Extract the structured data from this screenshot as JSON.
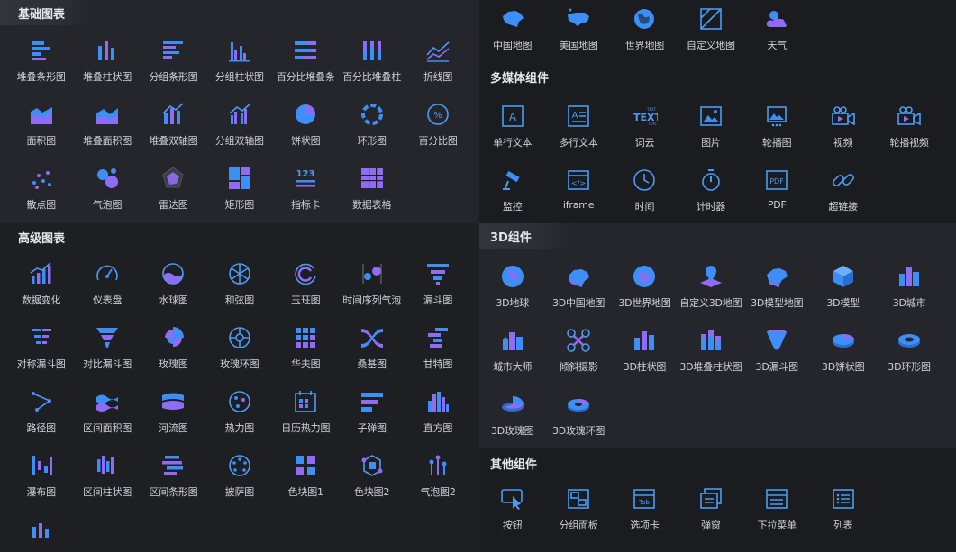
{
  "sections": {
    "basic": {
      "title": "基础图表",
      "items": [
        {
          "label": "堆叠条形图",
          "icon": "stacked-bar-icon"
        },
        {
          "label": "堆叠柱状图",
          "icon": "stacked-column-icon"
        },
        {
          "label": "分组条形图",
          "icon": "grouped-bar-icon"
        },
        {
          "label": "分组柱状图",
          "icon": "grouped-column-icon"
        },
        {
          "label": "百分比堆叠条",
          "icon": "percent-stacked-bar-icon"
        },
        {
          "label": "百分比堆叠柱",
          "icon": "percent-stacked-column-icon"
        },
        {
          "label": "折线图",
          "icon": "line-chart-icon"
        },
        {
          "label": "面积图",
          "icon": "area-chart-icon"
        },
        {
          "label": "堆叠面积图",
          "icon": "stacked-area-icon"
        },
        {
          "label": "堆叠双轴图",
          "icon": "stacked-dual-axis-icon"
        },
        {
          "label": "分组双轴图",
          "icon": "grouped-dual-axis-icon"
        },
        {
          "label": "饼状图",
          "icon": "pie-chart-icon"
        },
        {
          "label": "环形图",
          "icon": "ring-chart-icon"
        },
        {
          "label": "百分比图",
          "icon": "percent-chart-icon"
        },
        {
          "label": "散点图",
          "icon": "scatter-icon"
        },
        {
          "label": "气泡图",
          "icon": "bubble-icon"
        },
        {
          "label": "雷达图",
          "icon": "radar-icon"
        },
        {
          "label": "矩形图",
          "icon": "treemap-icon"
        },
        {
          "label": "指标卡",
          "icon": "kpi-card-icon"
        },
        {
          "label": "数据表格",
          "icon": "data-table-icon"
        }
      ]
    },
    "advanced": {
      "title": "高级图表",
      "items": [
        {
          "label": "数据变化",
          "icon": "data-change-icon"
        },
        {
          "label": "仪表盘",
          "icon": "gauge-icon"
        },
        {
          "label": "水球图",
          "icon": "liquid-fill-icon"
        },
        {
          "label": "和弦图",
          "icon": "chord-icon"
        },
        {
          "label": "玉玨图",
          "icon": "radial-bar-icon"
        },
        {
          "label": "时间序列气泡",
          "icon": "timeline-bubble-icon"
        },
        {
          "label": "漏斗图",
          "icon": "funnel-icon"
        },
        {
          "label": "对称漏斗图",
          "icon": "symmetric-funnel-icon"
        },
        {
          "label": "对比漏斗图",
          "icon": "compare-funnel-icon"
        },
        {
          "label": "玫瑰图",
          "icon": "rose-icon"
        },
        {
          "label": "玫瑰环图",
          "icon": "rose-ring-icon"
        },
        {
          "label": "华夫图",
          "icon": "waffle-icon"
        },
        {
          "label": "桑基图",
          "icon": "sankey-icon"
        },
        {
          "label": "甘特图",
          "icon": "gantt-icon"
        },
        {
          "label": "路径图",
          "icon": "path-icon"
        },
        {
          "label": "区间面积图",
          "icon": "range-area-icon"
        },
        {
          "label": "河流图",
          "icon": "streamgraph-icon"
        },
        {
          "label": "热力图",
          "icon": "heatmap-icon"
        },
        {
          "label": "日历热力图",
          "icon": "calendar-heatmap-icon"
        },
        {
          "label": "子弹图",
          "icon": "bullet-icon"
        },
        {
          "label": "直方图",
          "icon": "histogram-icon"
        },
        {
          "label": "瀑布图",
          "icon": "waterfall-icon"
        },
        {
          "label": "区间柱状图",
          "icon": "range-column-icon"
        },
        {
          "label": "区间条形图",
          "icon": "range-bar-icon"
        },
        {
          "label": "披萨图",
          "icon": "pizza-icon"
        },
        {
          "label": "色块图1",
          "icon": "color-block-icon"
        },
        {
          "label": "色块图2",
          "icon": "color-block-2-icon"
        },
        {
          "label": "气泡图2",
          "icon": "bubble-2-icon"
        },
        {
          "label": "",
          "icon": "column-small-icon"
        }
      ]
    },
    "maps": {
      "items": [
        {
          "label": "中国地图",
          "icon": "china-map-icon"
        },
        {
          "label": "美国地图",
          "icon": "usa-map-icon"
        },
        {
          "label": "世界地图",
          "icon": "world-map-icon"
        },
        {
          "label": "自定义地图",
          "icon": "custom-map-icon"
        },
        {
          "label": "天气",
          "icon": "weather-icon"
        }
      ]
    },
    "media": {
      "title": "多媒体组件",
      "items": [
        {
          "label": "单行文本",
          "icon": "single-line-text-icon"
        },
        {
          "label": "多行文本",
          "icon": "multi-line-text-icon"
        },
        {
          "label": "词云",
          "icon": "word-cloud-icon"
        },
        {
          "label": "图片",
          "icon": "image-icon"
        },
        {
          "label": "轮播图",
          "icon": "carousel-icon"
        },
        {
          "label": "视频",
          "icon": "video-icon"
        },
        {
          "label": "轮播视频",
          "icon": "carousel-video-icon"
        },
        {
          "label": "监控",
          "icon": "camera-monitor-icon"
        },
        {
          "label": "iframe",
          "icon": "iframe-icon"
        },
        {
          "label": "时间",
          "icon": "clock-icon"
        },
        {
          "label": "计时器",
          "icon": "stopwatch-icon"
        },
        {
          "label": "PDF",
          "icon": "pdf-icon"
        },
        {
          "label": "超链接",
          "icon": "link-icon"
        }
      ]
    },
    "three_d": {
      "title": "3D组件",
      "items": [
        {
          "label": "3D地球",
          "icon": "globe-3d-icon"
        },
        {
          "label": "3D中国地图",
          "icon": "china-map-3d-icon"
        },
        {
          "label": "3D世界地图",
          "icon": "world-map-3d-icon"
        },
        {
          "label": "自定义3D地图",
          "icon": "custom-map-3d-icon"
        },
        {
          "label": "3D模型地图",
          "icon": "model-map-3d-icon"
        },
        {
          "label": "3D模型",
          "icon": "cube-3d-icon"
        },
        {
          "label": "3D城市",
          "icon": "city-3d-icon"
        },
        {
          "label": "城市大师",
          "icon": "city-master-icon"
        },
        {
          "label": "倾斜摄影",
          "icon": "drone-icon"
        },
        {
          "label": "3D柱状图",
          "icon": "column-3d-icon"
        },
        {
          "label": "3D堆叠柱状图",
          "icon": "stacked-column-3d-icon"
        },
        {
          "label": "3D漏斗图",
          "icon": "funnel-3d-icon"
        },
        {
          "label": "3D饼状图",
          "icon": "pie-3d-icon"
        },
        {
          "label": "3D环形图",
          "icon": "ring-3d-icon"
        },
        {
          "label": "3D玫瑰图",
          "icon": "rose-3d-icon"
        },
        {
          "label": "3D玫瑰环图",
          "icon": "rose-ring-3d-icon"
        }
      ]
    },
    "other": {
      "title": "其他组件",
      "items": [
        {
          "label": "按钮",
          "icon": "button-icon"
        },
        {
          "label": "分组面板",
          "icon": "group-panel-icon"
        },
        {
          "label": "选项卡",
          "icon": "tab-icon"
        },
        {
          "label": "弹窗",
          "icon": "popup-icon"
        },
        {
          "label": "下拉菜单",
          "icon": "dropdown-icon"
        },
        {
          "label": "列表",
          "icon": "list-icon"
        }
      ]
    }
  },
  "colors": {
    "icon_blue": "#3d8ef7",
    "icon_purple": "#8f6cf5",
    "icon_outline": "#4a9cf5",
    "background_dark": "#1b1c20",
    "background_panel": "#25262c"
  }
}
